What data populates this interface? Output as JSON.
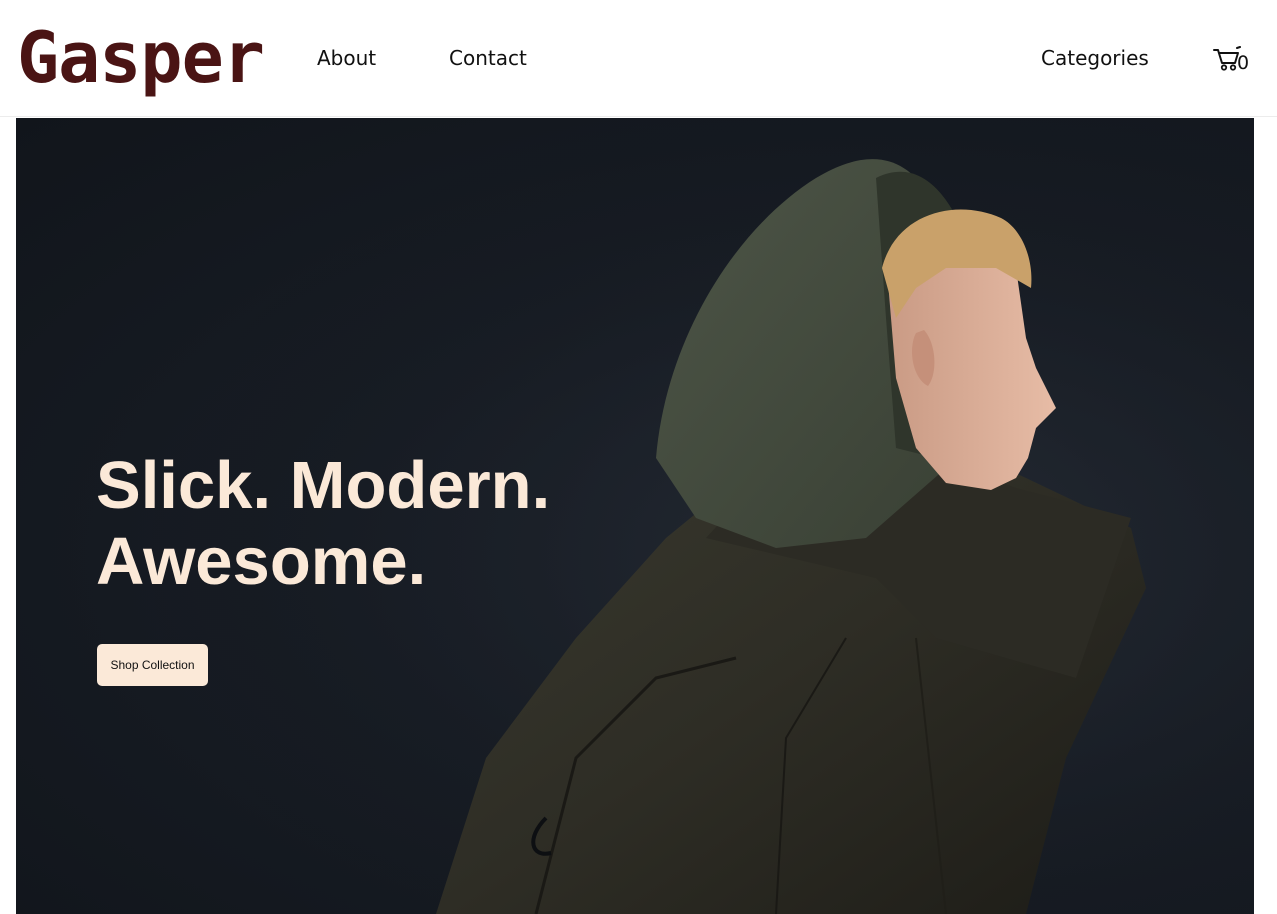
{
  "header": {
    "logo_text": "Gasper",
    "nav": {
      "about": "About",
      "contact": "Contact",
      "categories": "Categories"
    },
    "cart": {
      "icon": "shopping-cart-icon",
      "count": "0"
    }
  },
  "hero": {
    "heading_line1": "Slick. Modern.",
    "heading_line2": "Awesome.",
    "cta_label": "Shop Collection",
    "image": "model-in-dark-green-hooded-coat-profile"
  },
  "colors": {
    "logo": "#4a1414",
    "hero_text": "#fbe9d8",
    "button_bg": "#fbe9d8",
    "hero_bg": "#171c24"
  }
}
